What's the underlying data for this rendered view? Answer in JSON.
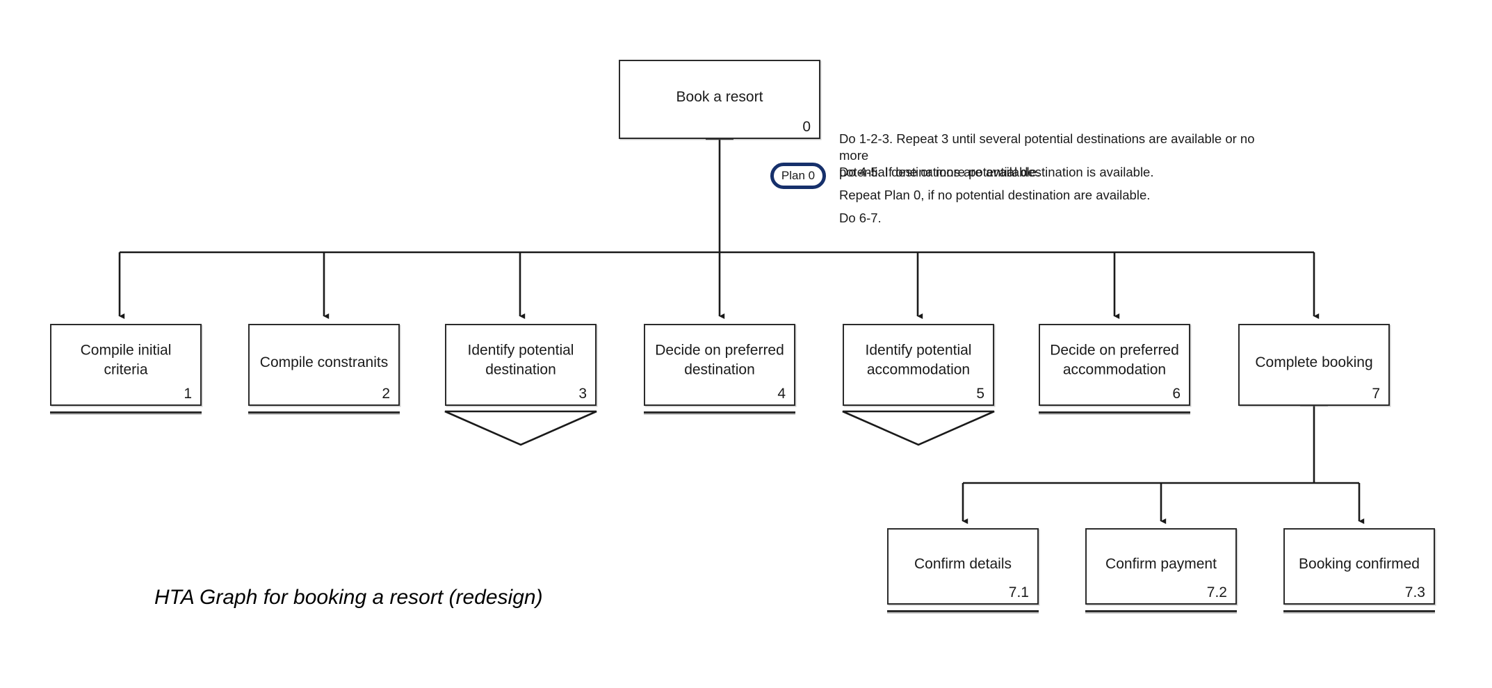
{
  "diagram": {
    "caption": "HTA Graph for booking a resort (redesign)",
    "colors": {
      "box_border": "#2b2b2b",
      "connector": "#1a1a1a",
      "plan_badge_border": "#16306b",
      "background": "#ffffff"
    }
  },
  "root": {
    "label": "Book a resort",
    "number": "0"
  },
  "plan": {
    "badge_label": "Plan 0",
    "lines": [
      "Do 1-2-3. Repeat 3 until several potential destinations are available or no more\npotential destinations are available.",
      "Do 4-5. If one or more potential destination is available.",
      "Repeat Plan 0, if no potential destination are available.",
      "Do 6-7."
    ]
  },
  "level1": [
    {
      "label": "Compile initial\ncriteria",
      "number": "1",
      "marker": "underline"
    },
    {
      "label": "Compile constranits",
      "number": "2",
      "marker": "underline"
    },
    {
      "label": "Identify potential\ndestination",
      "number": "3",
      "marker": "chevron"
    },
    {
      "label": "Decide on preferred\ndestination",
      "number": "4",
      "marker": "underline"
    },
    {
      "label": "Identify potential\naccommodation",
      "number": "5",
      "marker": "chevron"
    },
    {
      "label": "Decide on preferred\naccommodation",
      "number": "6",
      "marker": "underline"
    },
    {
      "label": "Complete booking",
      "number": "7",
      "marker": "none"
    }
  ],
  "level2": [
    {
      "label": "Confirm details",
      "number": "7.1",
      "marker": "underline"
    },
    {
      "label": "Confirm payment",
      "number": "7.2",
      "marker": "underline"
    },
    {
      "label": "Booking confirmed",
      "number": "7.3",
      "marker": "underline"
    }
  ]
}
